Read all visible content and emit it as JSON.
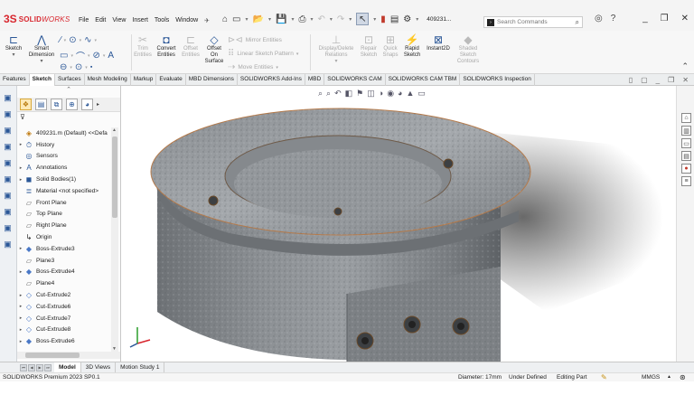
{
  "app": {
    "brand_prefix": "3S",
    "brand_solid": "SOLID",
    "brand_works": "WORKS",
    "document": "409231..."
  },
  "menu": [
    "File",
    "Edit",
    "View",
    "Insert",
    "Tools",
    "Window"
  ],
  "search": {
    "placeholder": "Search Commands"
  },
  "commands": {
    "sketch": "Sketch",
    "smart_dimension_1": "Smart",
    "smart_dimension_2": "Dimension",
    "trim_1": "Trim",
    "trim_2": "Entities",
    "convert_1": "Convert",
    "convert_2": "Entities",
    "offset_entities_1": "Offset",
    "offset_entities_2": "Entities",
    "offset_surface_1": "Offset",
    "offset_surface_2": "On",
    "offset_surface_3": "Surface",
    "mirror": "Mirror Entities",
    "linear_pattern": "Linear Sketch Pattern",
    "move": "Move Entities",
    "display_delete_1": "Display/Delete",
    "display_delete_2": "Relations",
    "repair_1": "Repair",
    "repair_2": "Sketch",
    "quick_snaps_1": "Quick",
    "quick_snaps_2": "Snaps",
    "rapid_1": "Rapid",
    "rapid_2": "Sketch",
    "instant2d": "Instant2D",
    "shaded_1": "Shaded",
    "shaded_2": "Sketch",
    "shaded_3": "Contours"
  },
  "tabs": [
    "Features",
    "Sketch",
    "Surfaces",
    "Mesh Modeling",
    "Markup",
    "Evaluate",
    "MBD Dimensions",
    "SOLIDWORKS Add-Ins",
    "MBD",
    "SOLIDWORKS CAM",
    "SOLIDWORKS CAM TBM",
    "SOLIDWORKS Inspection"
  ],
  "active_tab": "Sketch",
  "tree": {
    "root": "409231.m (Default) <<Defa",
    "items": [
      {
        "label": "History",
        "icon": "history-icon",
        "expandable": true
      },
      {
        "label": "Sensors",
        "icon": "sensors-icon",
        "expandable": false
      },
      {
        "label": "Annotations",
        "icon": "annotations-icon",
        "expandable": true
      },
      {
        "label": "Solid Bodies(1)",
        "icon": "solid-bodies-icon",
        "expandable": true
      },
      {
        "label": "Material <not specified>",
        "icon": "material-icon",
        "expandable": false
      },
      {
        "label": "Front Plane",
        "icon": "plane-icon",
        "expandable": false
      },
      {
        "label": "Top Plane",
        "icon": "plane-icon",
        "expandable": false
      },
      {
        "label": "Right Plane",
        "icon": "plane-icon",
        "expandable": false
      },
      {
        "label": "Origin",
        "icon": "origin-icon",
        "expandable": false
      },
      {
        "label": "Boss-Extrude3",
        "icon": "extrude-icon",
        "expandable": true
      },
      {
        "label": "Plane3",
        "icon": "plane-icon",
        "expandable": false
      },
      {
        "label": "Boss-Extrude4",
        "icon": "extrude-icon",
        "expandable": true
      },
      {
        "label": "Plane4",
        "icon": "plane-icon",
        "expandable": false
      },
      {
        "label": "Cut-Extrude2",
        "icon": "cut-extrude-icon",
        "expandable": true
      },
      {
        "label": "Cut-Extrude6",
        "icon": "cut-extrude-icon",
        "expandable": true
      },
      {
        "label": "Cut-Extrude7",
        "icon": "cut-extrude-icon",
        "expandable": true
      },
      {
        "label": "Cut-Extrude8",
        "icon": "cut-extrude-icon",
        "expandable": true
      },
      {
        "label": "Boss-Extrude6",
        "icon": "extrude-icon",
        "expandable": true
      }
    ]
  },
  "bottom_tabs": [
    "Model",
    "3D Views",
    "Motion Study 1"
  ],
  "active_bottom_tab": "Model",
  "status": {
    "product": "SOLIDWORKS Premium 2023 SP0.1",
    "diameter": "Diameter: 17mm",
    "state": "Under Defined",
    "editing": "Editing Part",
    "units": "MMGS"
  },
  "colors": {
    "brand_red": "#d8262e",
    "accent_blue": "#2b5797",
    "part_steel": "#8a8d90"
  }
}
